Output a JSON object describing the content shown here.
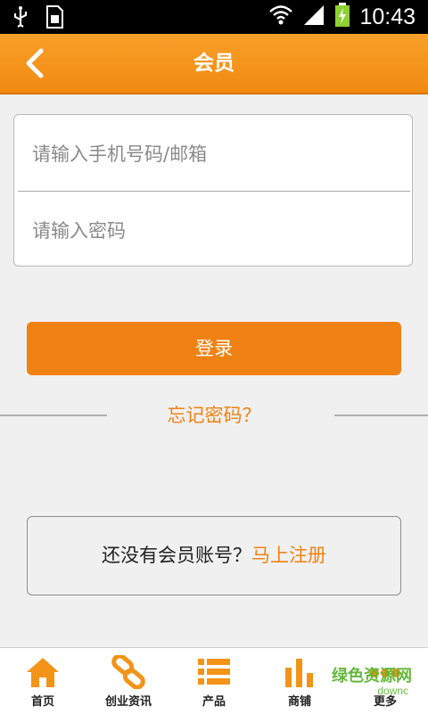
{
  "status_bar": {
    "time": "10:43"
  },
  "header": {
    "title": "会员"
  },
  "form": {
    "phone_placeholder": "请输入手机号码/邮箱",
    "password_placeholder": "请输入密码"
  },
  "login_label": "登录",
  "forgot_label": "忘记密码？",
  "register": {
    "prompt": "还没有会员账号？",
    "link": "马上注册"
  },
  "tabs": [
    {
      "label": "首页",
      "icon": "home-icon"
    },
    {
      "label": "创业资讯",
      "icon": "link-icon"
    },
    {
      "label": "产品",
      "icon": "list-icon"
    },
    {
      "label": "商铺",
      "icon": "bar-chart-icon"
    },
    {
      "label": "更多",
      "icon": "more-icon"
    }
  ],
  "watermark": {
    "logo_text": "绿色资源网",
    "url_text": "downc"
  },
  "colors": {
    "accent": "#f08214",
    "header": "#f39318",
    "background": "#f0f0f0"
  }
}
